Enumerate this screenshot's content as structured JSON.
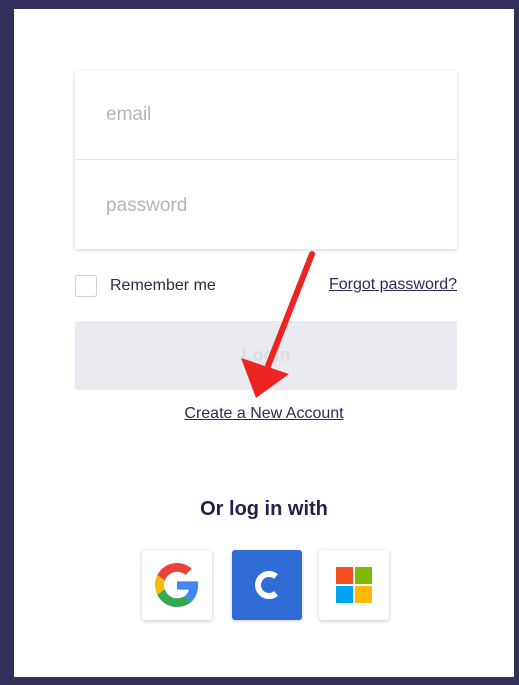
{
  "form": {
    "email_placeholder": "email",
    "password_placeholder": "password",
    "remember_label": "Remember me",
    "forgot_label": "Forgot password?",
    "login_label": "Login",
    "create_account_label": "Create a New Account"
  },
  "social": {
    "title": "Or log in with",
    "providers": [
      {
        "name": "google",
        "icon": "google-icon"
      },
      {
        "name": "c",
        "icon": "c-letter-icon",
        "color": "#2f6cd6"
      },
      {
        "name": "microsoft",
        "icon": "microsoft-icon"
      }
    ]
  },
  "annotation": {
    "arrow_color": "#ee2323"
  }
}
